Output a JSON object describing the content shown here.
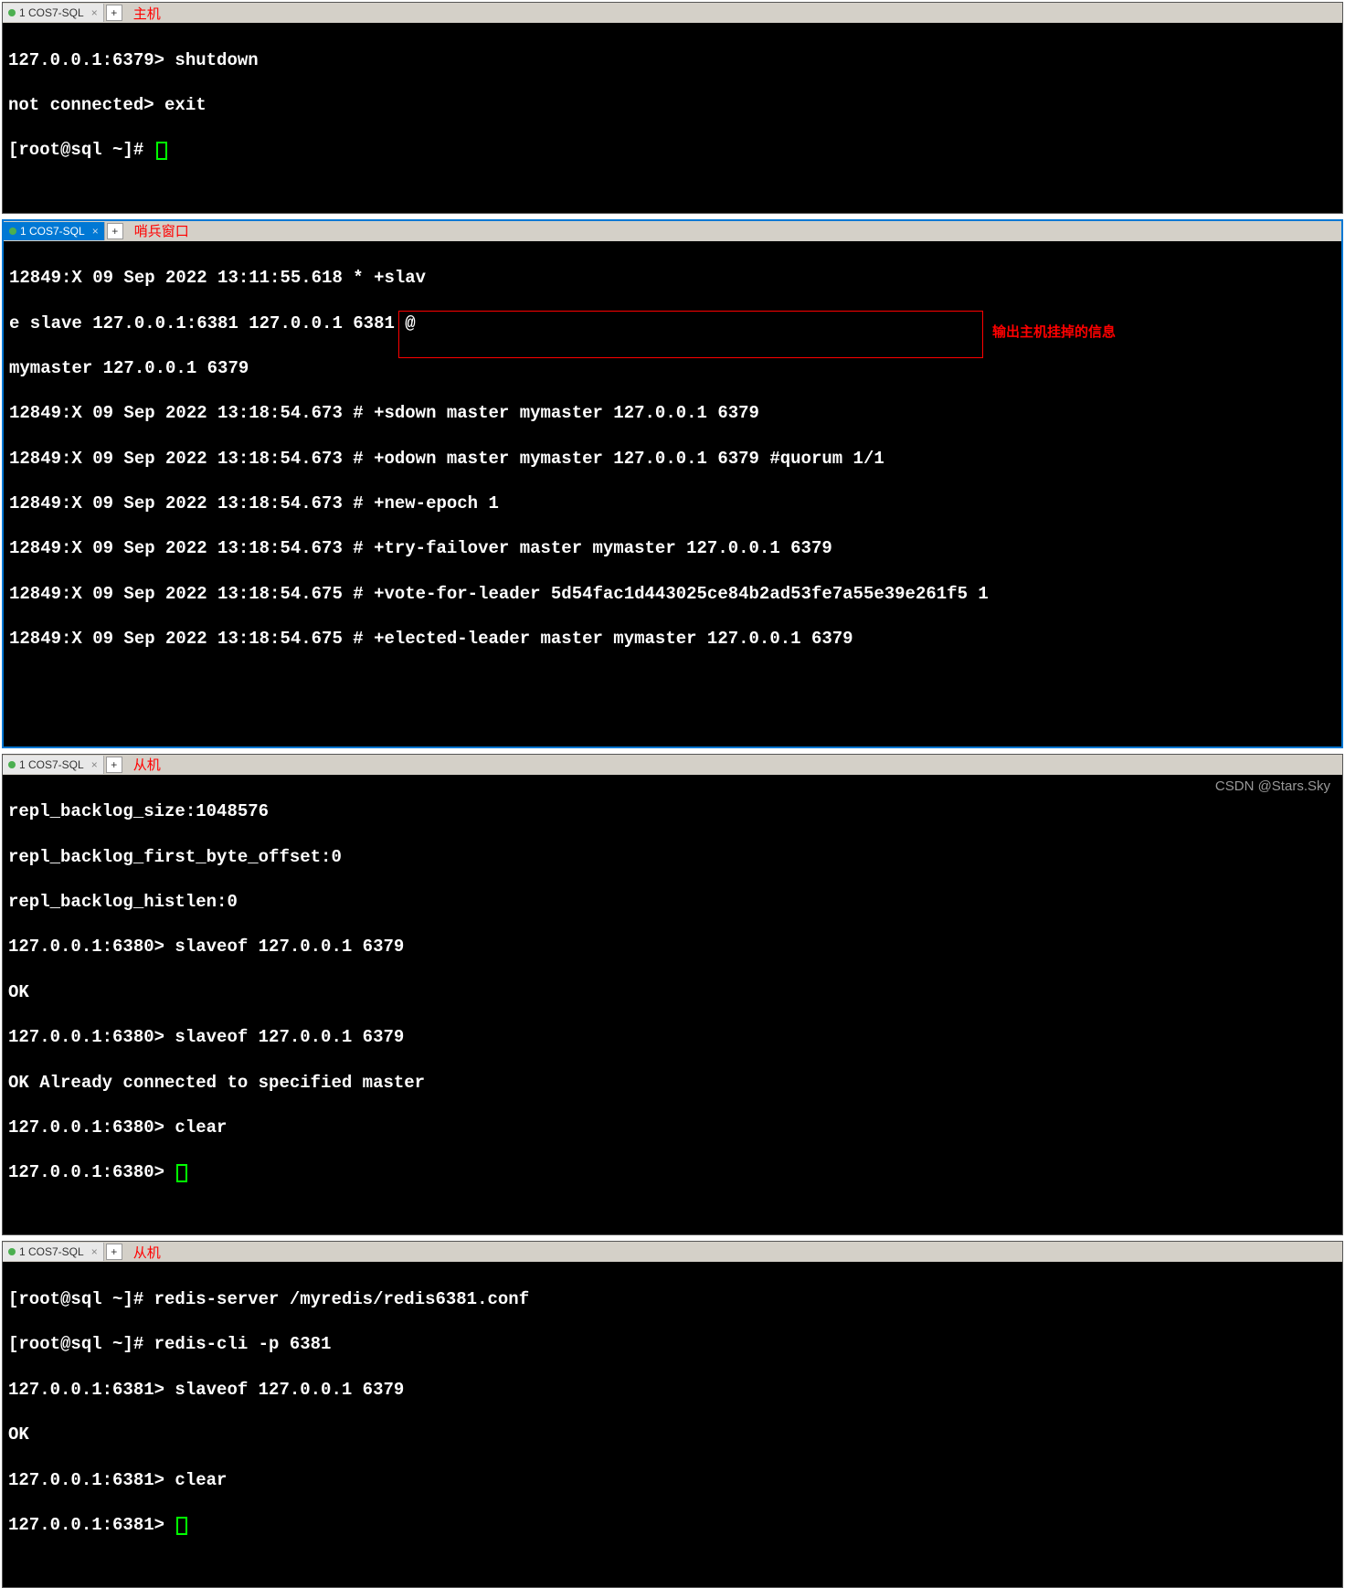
{
  "tabs": {
    "label": "1 COS7-SQL",
    "add_symbol": "+",
    "close_symbol": "×"
  },
  "annotations": {
    "panel1_label": "主机",
    "panel2_label": "哨兵窗口",
    "panel3_label": "从机",
    "panel4_label": "从机",
    "box_text": "输出主机挂掉的信息"
  },
  "panel1": {
    "lines": [
      "127.0.0.1:6379> shutdown",
      "not connected> exit",
      "[root@sql ~]# "
    ]
  },
  "panel2": {
    "lines": [
      "12849:X 09 Sep 2022 13:11:55.618 * +slav",
      "e slave 127.0.0.1:6381 127.0.0.1 6381 @",
      "mymaster 127.0.0.1 6379",
      "12849:X 09 Sep 2022 13:18:54.673 # +sdown master mymaster 127.0.0.1 6379",
      "12849:X 09 Sep 2022 13:18:54.673 # +odown master mymaster 127.0.0.1 6379 #quorum 1/1",
      "12849:X 09 Sep 2022 13:18:54.673 # +new-epoch 1",
      "12849:X 09 Sep 2022 13:18:54.673 # +try-failover master mymaster 127.0.0.1 6379",
      "12849:X 09 Sep 2022 13:18:54.675 # +vote-for-leader 5d54fac1d443025ce84b2ad53fe7a55e39e261f5 1",
      "12849:X 09 Sep 2022 13:18:54.675 # +elected-leader master mymaster 127.0.0.1 6379"
    ]
  },
  "panel3": {
    "lines": [
      "repl_backlog_size:1048576",
      "repl_backlog_first_byte_offset:0",
      "repl_backlog_histlen:0",
      "127.0.0.1:6380> slaveof 127.0.0.1 6379",
      "OK",
      "127.0.0.1:6380> slaveof 127.0.0.1 6379",
      "OK Already connected to specified master",
      "127.0.0.1:6380> clear",
      "127.0.0.1:6380> "
    ]
  },
  "panel4": {
    "lines": [
      "[root@sql ~]# redis-server /myredis/redis6381.conf",
      "[root@sql ~]# redis-cli -p 6381",
      "127.0.0.1:6381> slaveof 127.0.0.1 6379",
      "OK",
      "127.0.0.1:6381> clear",
      "127.0.0.1:6381> "
    ]
  },
  "watermark": "CSDN @Stars.Sky"
}
